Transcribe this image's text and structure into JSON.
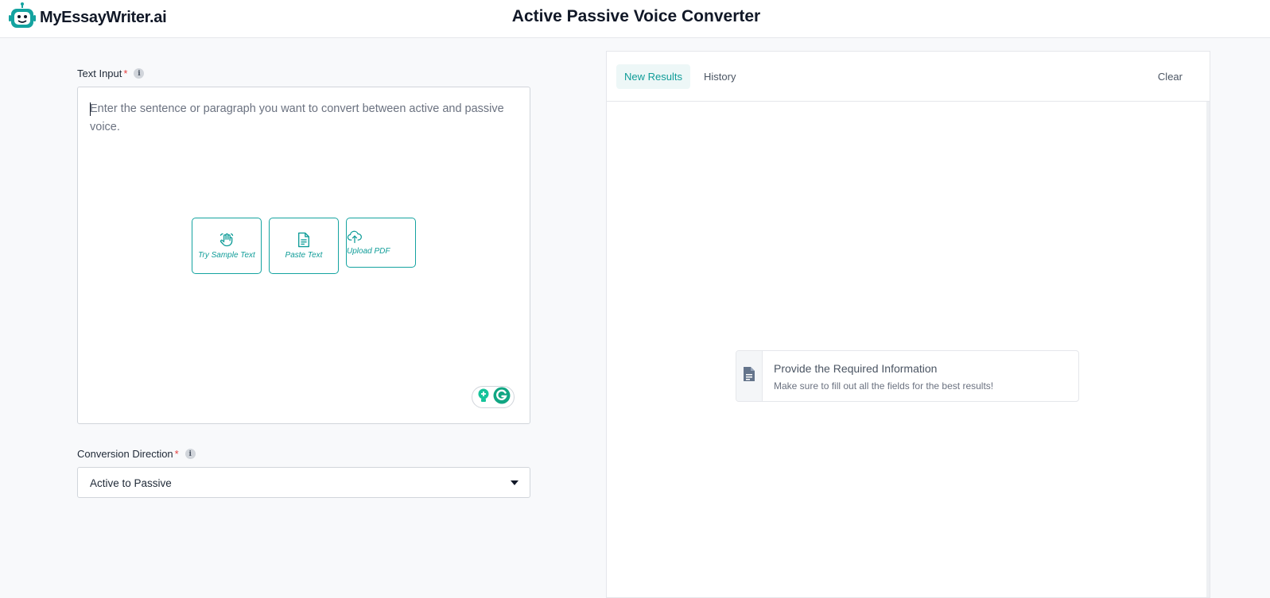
{
  "header": {
    "brand": "MyEssayWriter.ai",
    "title": "Active Passive Voice Converter",
    "logo_icon": "robot-icon"
  },
  "text_input": {
    "label": "Text Input",
    "required_mark": "*",
    "info_glyph": "i",
    "placeholder": "Enter the sentence or paragraph you want to convert between active and passive voice.",
    "actions": [
      {
        "label": "Try Sample Text",
        "icon": "wave-hand-icon"
      },
      {
        "label": "Paste Text",
        "icon": "document-icon"
      },
      {
        "label": "Upload PDF",
        "icon": "cloud-upload-icon"
      }
    ]
  },
  "conversion": {
    "label": "Conversion Direction",
    "required_mark": "*",
    "info_glyph": "i",
    "selected": "Active to Passive"
  },
  "results": {
    "tabs": {
      "new": "New Results",
      "history": "History",
      "clear": "Clear"
    },
    "notice_title": "Provide the Required Information",
    "notice_subtitle": "Make sure to fill out all the fields for the best results!"
  },
  "colors": {
    "accent": "#0f9c98",
    "required": "#e53e3e",
    "grammarly": "#15c39a"
  }
}
